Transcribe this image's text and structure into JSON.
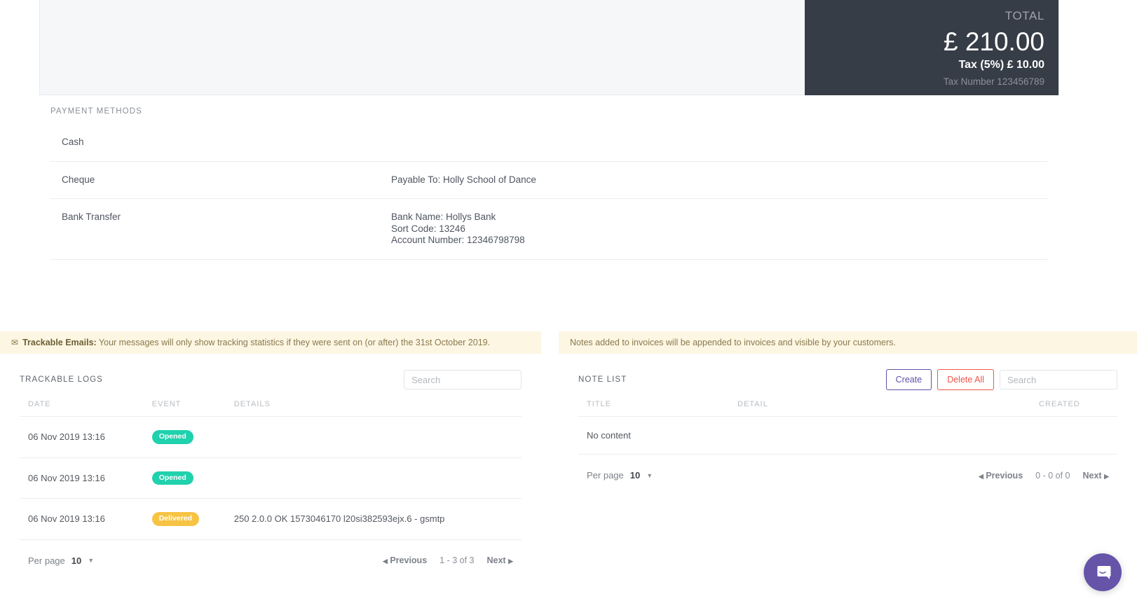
{
  "invoice": {
    "total_label": "TOTAL",
    "total_amount": "£ 210.00",
    "tax_line": "Tax (5%) £ 10.00",
    "tax_number": "Tax Number 123456789",
    "panel_bg": "#373d47"
  },
  "payment_methods": {
    "heading": "PAYMENT METHODS",
    "rows": [
      {
        "name": "Cash",
        "detail": ""
      },
      {
        "name": "Cheque",
        "detail": "Payable To: Holly School of Dance"
      },
      {
        "name": "Bank Transfer",
        "detail": "Bank Name: Hollys Bank\nSort Code: 13246\nAccount Number: 12346798798"
      }
    ]
  },
  "banners": {
    "trackable": {
      "icon": "envelope-icon",
      "strong": "Trackable Emails:",
      "text": " Your messages will only show tracking statistics if they were sent on (or after) the 31st October 2019.",
      "bg": "#fdf6e3"
    },
    "notes": {
      "text": "Notes added to invoices will be appended to invoices and visible by your customers.",
      "bg": "#fdf6e3"
    }
  },
  "trackable_logs": {
    "title": "TRACKABLE LOGS",
    "search_placeholder": "Search",
    "search_value": "",
    "columns": [
      "DATE",
      "EVENT",
      "DETAILS"
    ],
    "rows": [
      {
        "date": "06 Nov 2019 13:16",
        "event": "Opened",
        "event_color": "#1fd1ac",
        "details": ""
      },
      {
        "date": "06 Nov 2019 13:16",
        "event": "Opened",
        "event_color": "#1fd1ac",
        "details": ""
      },
      {
        "date": "06 Nov 2019 13:16",
        "event": "Delivered",
        "event_color": "#f6c344",
        "details": "250 2.0.0 OK 1573046170 l20si382593ejx.6 - gsmtp"
      }
    ],
    "pager": {
      "per_page_label": "Per page",
      "per_page_value": "10",
      "previous": "Previous",
      "count": "1 - 3 of 3",
      "next": "Next"
    }
  },
  "note_list": {
    "title": "NOTE LIST",
    "create_label": "Create",
    "delete_all_label": "Delete All",
    "create_color": "#5f51a8",
    "delete_color": "#f2544a",
    "search_placeholder": "Search",
    "search_value": "",
    "columns": [
      "TITLE",
      "DETAIL",
      "CREATED"
    ],
    "empty_text": "No content",
    "pager": {
      "per_page_label": "Per page",
      "per_page_value": "10",
      "previous": "Previous",
      "count": "0 - 0 of 0",
      "next": "Next"
    }
  },
  "chat": {
    "icon": "chat-bubble-icon",
    "color": "#6554a8"
  }
}
